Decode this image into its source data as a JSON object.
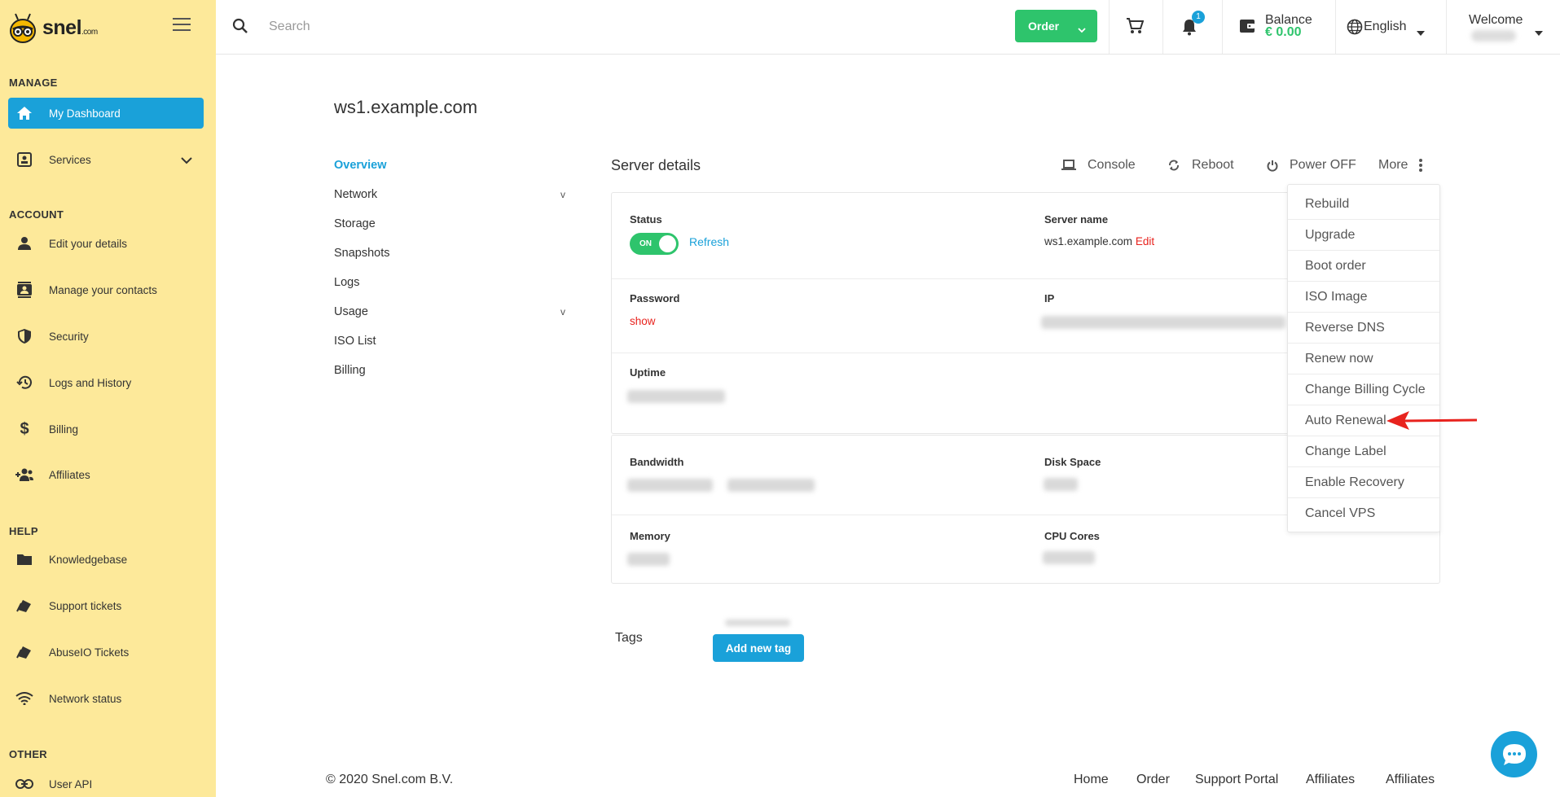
{
  "brand": {
    "name": "snel",
    "tld": ".com"
  },
  "sidebar": {
    "sections": {
      "manage": "MANAGE",
      "account": "ACCOUNT",
      "help": "HELP",
      "other": "OTHER"
    },
    "items": [
      {
        "label": "My Dashboard",
        "icon": "home-icon"
      },
      {
        "label": "Services",
        "icon": "services-icon"
      },
      {
        "label": "Edit your details",
        "icon": "person-icon"
      },
      {
        "label": "Manage your contacts",
        "icon": "contacts-icon"
      },
      {
        "label": "Security",
        "icon": "shield-icon"
      },
      {
        "label": "Logs and History",
        "icon": "history-icon"
      },
      {
        "label": "Billing",
        "icon": "dollar-icon"
      },
      {
        "label": "Affiliates",
        "icon": "group-add-icon"
      },
      {
        "label": "Knowledgebase",
        "icon": "folder-icon"
      },
      {
        "label": "Support tickets",
        "icon": "tickets-icon"
      },
      {
        "label": "AbuseIO Tickets",
        "icon": "tickets-icon"
      },
      {
        "label": "Network status",
        "icon": "wifi-icon"
      },
      {
        "label": "User API",
        "icon": "link-icon"
      }
    ]
  },
  "topbar": {
    "search_placeholder": "Search",
    "order_label": "Order",
    "notification_count": "1",
    "balance_label": "Balance",
    "balance_value": "€ 0.00",
    "language": "English",
    "welcome": "Welcome"
  },
  "page": {
    "title": "ws1.example.com",
    "subnav": [
      {
        "label": "Overview"
      },
      {
        "label": "Network",
        "caret": "v"
      },
      {
        "label": "Storage"
      },
      {
        "label": "Snapshots"
      },
      {
        "label": "Logs"
      },
      {
        "label": "Usage",
        "caret": "v"
      },
      {
        "label": "ISO List"
      },
      {
        "label": "Billing"
      }
    ]
  },
  "server_details": {
    "title": "Server details",
    "actions": {
      "console": "Console",
      "reboot": "Reboot",
      "power_off": "Power OFF",
      "more": "More"
    },
    "fields": {
      "status_label": "Status",
      "status_toggle": "ON",
      "refresh": "Refresh",
      "server_name_label": "Server name",
      "server_name_value": "ws1.example.com",
      "edit": "Edit",
      "password_label": "Password",
      "show": "show",
      "ip_label": "IP",
      "uptime_label": "Uptime",
      "bandwidth_label": "Bandwidth",
      "disk_space_label": "Disk Space",
      "memory_label": "Memory",
      "cpu_cores_label": "CPU Cores"
    }
  },
  "more_menu": [
    "Rebuild",
    "Upgrade",
    "Boot order",
    "ISO Image",
    "Reverse DNS",
    "Renew now",
    "Change Billing Cycle",
    "Auto Renewal",
    "Change Label",
    "Enable Recovery",
    "Cancel VPS"
  ],
  "tags": {
    "title": "Tags",
    "add_label": "Add new tag"
  },
  "footer": {
    "copyright": "© 2020 Snel.com B.V.",
    "links": [
      "Home",
      "Order",
      "Support Portal",
      "Affiliates",
      "Affiliates"
    ]
  },
  "colors": {
    "sidebar_bg": "#fde99a",
    "accent_blue": "#1aa1d9",
    "accent_green": "#2ec46c",
    "accent_red": "#e8231e"
  }
}
